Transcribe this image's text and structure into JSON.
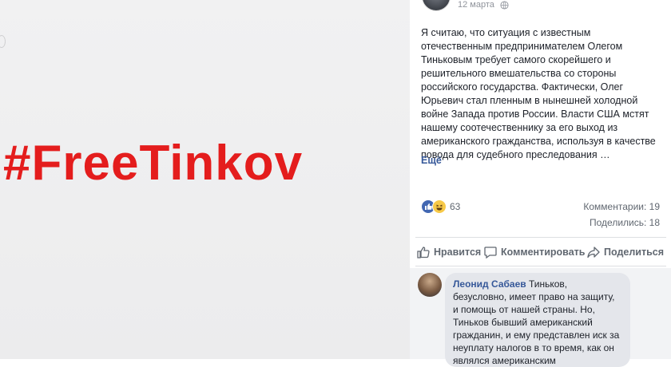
{
  "photo": {
    "hashtag": "#FreeTinkov"
  },
  "post": {
    "date": "12 марта",
    "text": "Я считаю, что ситуация с известным отечественным предпринимателем Олегом Тиньковым требует самого скорейшего и решительного вмешательства со стороны российского государства. Фактически, Олег Юрьевич стал пленным в нынешней холодной войне Запада против России. Власти США мстят нашему соотечественнику за его выход из американского гражданства, используя в качестве повода для судебного преследования …",
    "more_label": "Ещё",
    "reactions_count": "63",
    "comments_count": "Комментарии: 19",
    "shares_count": "Поделились: 18"
  },
  "actions": {
    "like_label": "Нравится",
    "comment_label": "Комментировать",
    "share_label": "Поделиться"
  },
  "comment": {
    "author": "Леонид Сабаев",
    "text": "Тиньков, безусловно, имеет право на защиту, и помощь от нашей страны. Но, Тиньков бывший американский гражданин, и ему представлен иск за неуплату налогов в то время, как он являлся американским"
  },
  "colors": {
    "hashtag": "#e41d1d",
    "link": "#365899",
    "muted": "#606770"
  },
  "icons": [
    "globe-icon",
    "like-reaction-icon",
    "haha-reaction-icon",
    "thumbs-up-icon",
    "comment-icon",
    "share-arrow-icon"
  ]
}
